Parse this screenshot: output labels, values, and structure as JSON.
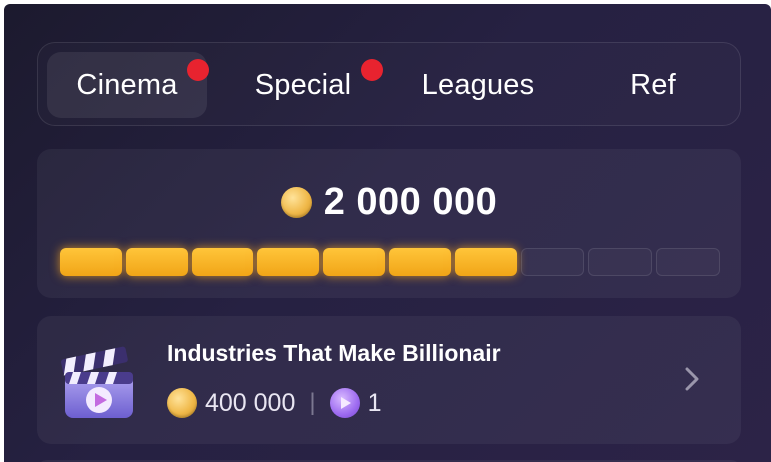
{
  "tabs": [
    {
      "label": "Cinema",
      "active": true,
      "has_notification": true
    },
    {
      "label": "Special",
      "active": false,
      "has_notification": true
    },
    {
      "label": "Leagues",
      "active": false,
      "has_notification": false
    },
    {
      "label": "Ref",
      "active": false,
      "has_notification": false
    }
  ],
  "balance": {
    "value": "2 000 000",
    "icon": "coin-icon",
    "progress_filled_segments": 7,
    "progress_total_segments": 10
  },
  "tasks": [
    {
      "title": "Industries That Make Billionair",
      "icon": "clapperboard-icon",
      "coin_reward": "400 000",
      "ticket_reward": "1",
      "separator": "|"
    }
  ],
  "colors": {
    "background": "#231f38",
    "accent_gold": "#f5b026",
    "notification_red": "#e8232f",
    "ticket_purple": "#9d6bf0"
  }
}
